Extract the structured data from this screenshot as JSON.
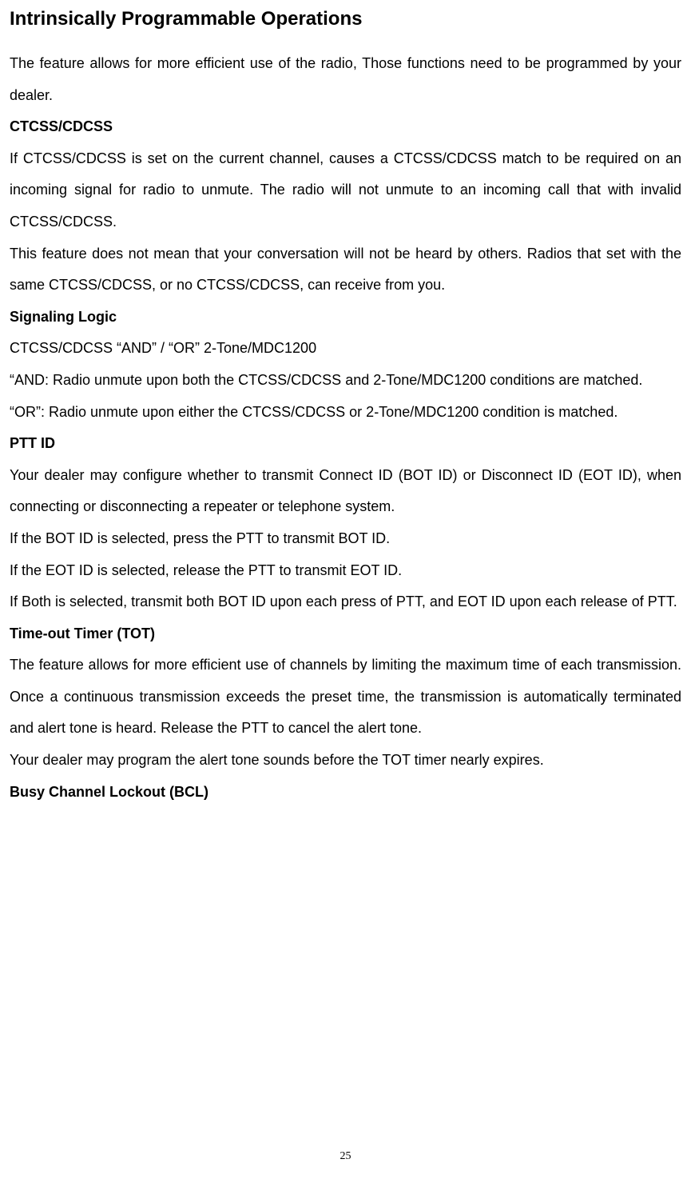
{
  "heading": "Intrinsically Programmable Operations",
  "intro": "The feature allows for more efficient use of the radio, Those functions need to be programmed by your dealer.",
  "sections": {
    "ctcss": {
      "title": "CTCSS/CDCSS",
      "p1": "If CTCSS/CDCSS is set on the current channel, causes a CTCSS/CDCSS match to be required on an incoming signal for radio to unmute. The radio will not unmute to an incoming call that with invalid CTCSS/CDCSS.",
      "p2": "This feature does not mean that your conversation will not be heard by others. Radios that set with the same CTCSS/CDCSS, or no CTCSS/CDCSS, can receive from you."
    },
    "signaling": {
      "title": "Signaling Logic",
      "p1": "CTCSS/CDCSS “AND” / “OR” 2-Tone/MDC1200",
      "p2": "“AND: Radio unmute upon both the CTCSS/CDCSS and 2-Tone/MDC1200 conditions are matched.",
      "p3": "“OR”: Radio unmute upon either the CTCSS/CDCSS or 2-Tone/MDC1200 condition is matched."
    },
    "pttid": {
      "title": "PTT ID",
      "p1": "Your dealer may configure whether to transmit Connect ID (BOT ID) or Disconnect ID (EOT ID), when connecting or disconnecting a repeater or telephone system.",
      "p2": "If the BOT ID is selected, press the PTT to transmit BOT ID.",
      "p3": "If the EOT ID is selected, release the PTT to transmit EOT ID.",
      "p4": "If Both is selected, transmit both BOT ID upon each press of PTT, and EOT ID upon each release of PTT."
    },
    "tot": {
      "title": "Time-out Timer (TOT)",
      "p1": "The feature allows for more efficient use of channels by limiting the maximum time of each transmission. Once a continuous transmission exceeds the preset time, the transmission is automatically terminated and alert tone is heard. Release the PTT to cancel the alert tone.",
      "p2": "Your dealer may program the alert tone sounds before the TOT timer nearly expires."
    },
    "bcl": {
      "title": "Busy Channel Lockout (BCL)"
    }
  },
  "page_number": "25"
}
